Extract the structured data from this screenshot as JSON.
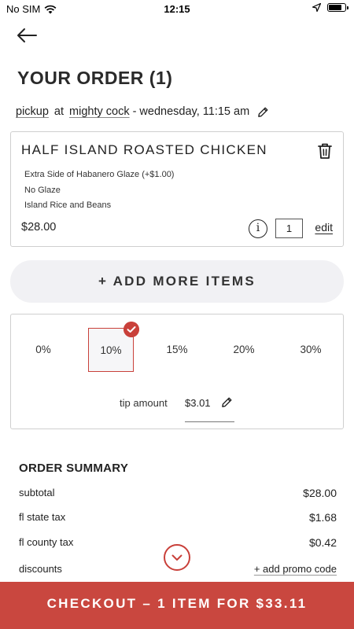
{
  "status_bar": {
    "carrier": "No SIM",
    "time": "12:15",
    "battery_level": 0.85,
    "icons": [
      "wifi-icon",
      "location-arrow-icon",
      "battery-icon"
    ]
  },
  "header": {
    "back_icon": "arrow-left-icon",
    "title": "YOUR ORDER (1)"
  },
  "order_info": {
    "mode": "pickup",
    "at": "at",
    "location": "mighty cock",
    "when": "- wednesday, 11:15 am",
    "edit_icon": "pencil-icon"
  },
  "item": {
    "name": "HALF ISLAND ROASTED CHICKEN",
    "modifiers": [
      "Extra Side of Habanero Glaze (+$1.00)",
      "No Glaze",
      "Island Rice and Beans"
    ],
    "price": "$28.00",
    "quantity": "1",
    "edit_label": "edit",
    "info_label": "i",
    "delete_icon": "trash-icon"
  },
  "add_more_label": "+ ADD MORE ITEMS",
  "tip": {
    "options": [
      "0%",
      "10%",
      "15%",
      "20%",
      "30%"
    ],
    "selected_index": 1,
    "amount_label": "tip amount",
    "amount_value": "$3.01"
  },
  "summary": {
    "title": "ORDER SUMMARY",
    "rows": [
      {
        "label": "subtotal",
        "value": "$28.00"
      },
      {
        "label": "fl state tax",
        "value": "$1.68"
      },
      {
        "label": "fl county tax",
        "value": "$0.42"
      }
    ],
    "discounts_label": "discounts",
    "promo_label": "+ add promo code"
  },
  "checkout_label": "CHECKOUT – 1 ITEM FOR $33.11",
  "colors": {
    "accent": "#c9473f",
    "selected_border": "#c9403a",
    "add_more_bg": "#f1f1f4"
  }
}
